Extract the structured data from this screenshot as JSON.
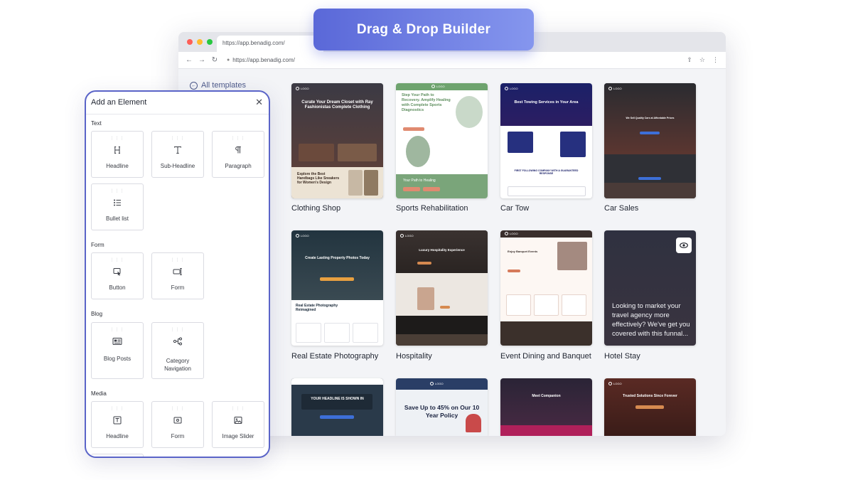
{
  "badge": {
    "label": "Drag & Drop Builder"
  },
  "browser": {
    "tab_url": "https://app.benadig.com/",
    "address_url": "https://app.benadig.com/",
    "colors": {
      "red": "#fe5f57",
      "yellow": "#febc2e",
      "green": "#28c840"
    }
  },
  "content": {
    "all_templates_label": "All templates",
    "templates": [
      {
        "label": "Clothing Shop",
        "thumb_title": "Curate Your Dream Closet with Ray Fashionistas Complete Clothing",
        "sub_title": "Explore the Best Handbags Like Sneakers for Women's Design"
      },
      {
        "label": "Sports Rehabilitation",
        "thumb_title": "Step Your Path to Recovery. Amplify Healing with Complete Sports Diagnostics",
        "footer_text": "Your Path to Healing"
      },
      {
        "label": "Car Tow",
        "thumb_title": "Best Towing Services in Your Area",
        "mid_text": "FIRST FOLLOWING COMPANY WITH A GUARANTEED RESPONSE"
      },
      {
        "label": "Car Sales",
        "thumb_title": "We Sell Quality Cars at Affordable Prices"
      },
      {
        "label": "Real Estate Photography",
        "thumb_title": "Create Lasting Property Photos Today",
        "sub_title": "Real Estate Photography Reimagined"
      },
      {
        "label": "Hospitality",
        "thumb_title": "Luxury Hospitality Experience"
      },
      {
        "label": "Event Dining and Banquet",
        "thumb_title": "Enjoy Banquet Events"
      },
      {
        "label": "Hotel Stay",
        "overlay_text": "Looking to market your travel agency more effectively? We've get you covered with this funnal..."
      },
      {
        "label": "",
        "thumb_title": "YOUR HEADLINE IS SHOWN IN"
      },
      {
        "label": "",
        "promo_text": "Save Up to 45% on Our 10 Year Policy"
      },
      {
        "label": "",
        "thumb_title": "Meet Companion"
      },
      {
        "label": "",
        "thumb_title": "Trusted Solutions Since Forever"
      }
    ]
  },
  "panel": {
    "title": "Add an Element",
    "sections": {
      "text": "Text",
      "form": "Form",
      "blog": "Blog",
      "media": "Media"
    },
    "elements": {
      "headline": "Headline",
      "sub_headline": "Sub-Headline",
      "paragraph": "Paragraph",
      "bullet_list": "Bullet list",
      "button": "Button",
      "form": "Form",
      "blog_posts": "Blog Posts",
      "category_navigation": "Category Navigation",
      "media_headline": "Headline",
      "media_form": "Form",
      "image_slider": "Image Slider"
    }
  }
}
